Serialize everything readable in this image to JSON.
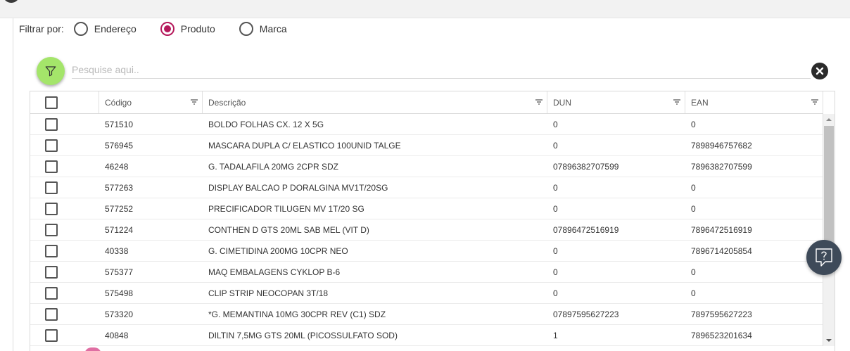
{
  "filter": {
    "label": "Filtrar por:",
    "options": [
      {
        "label": "Endereço",
        "checked": false
      },
      {
        "label": "Produto",
        "checked": true
      },
      {
        "label": "Marca",
        "checked": false
      }
    ]
  },
  "search": {
    "placeholder": "Pesquise aqui.."
  },
  "grid": {
    "columns": [
      "Código",
      "Descrição",
      "DUN",
      "EAN"
    ],
    "rows": [
      {
        "codigo": "571510",
        "descricao": "BOLDO FOLHAS CX. 12 X 5G",
        "dun": "0",
        "ean": "0"
      },
      {
        "codigo": "576945",
        "descricao": "MASCARA DUPLA C/ ELASTICO 100UNID TALGE",
        "dun": "0",
        "ean": "7898946757682"
      },
      {
        "codigo": "46248",
        "descricao": "G. TADALAFILA 20MG 2CPR SDZ",
        "dun": "07896382707599",
        "ean": "7896382707599"
      },
      {
        "codigo": "577263",
        "descricao": "DISPLAY BALCAO P DORALGINA MV1T/20SG",
        "dun": "0",
        "ean": "0"
      },
      {
        "codigo": "577252",
        "descricao": "PRECIFICADOR TILUGEN MV 1T/20 SG",
        "dun": "0",
        "ean": "0"
      },
      {
        "codigo": "571224",
        "descricao": "CONTHEN D GTS 20ML SAB MEL (VIT D)",
        "dun": "07896472516919",
        "ean": "7896472516919"
      },
      {
        "codigo": "40338",
        "descricao": "G. CIMETIDINA 200MG 10CPR NEO",
        "dun": "0",
        "ean": "7896714205854"
      },
      {
        "codigo": "575377",
        "descricao": "MAQ EMBALAGENS CYKLOP B-6",
        "dun": "0",
        "ean": "0"
      },
      {
        "codigo": "575498",
        "descricao": "CLIP STRIP NEOCOPAN 3T/18",
        "dun": "0",
        "ean": "0"
      },
      {
        "codigo": "573320",
        "descricao": "*G. MEMANTINA 10MG 30CPR REV (C1) SDZ",
        "dun": "07897595627223",
        "ean": "7897595627223"
      },
      {
        "codigo": "40848",
        "descricao": "DILTIN 7,5MG GTS 20ML (PICOSSULFATO SOD)",
        "dun": "1",
        "ean": "7896523201634"
      }
    ]
  },
  "icons": {
    "filter": "funnel-icon",
    "clear": "close-circle-icon",
    "help": "help-question-icon",
    "column_menu": "menu-lines-icon"
  },
  "colors": {
    "accent": "#b5195b",
    "filter_button": "#a4e56a",
    "help_button": "#3e4a59"
  }
}
